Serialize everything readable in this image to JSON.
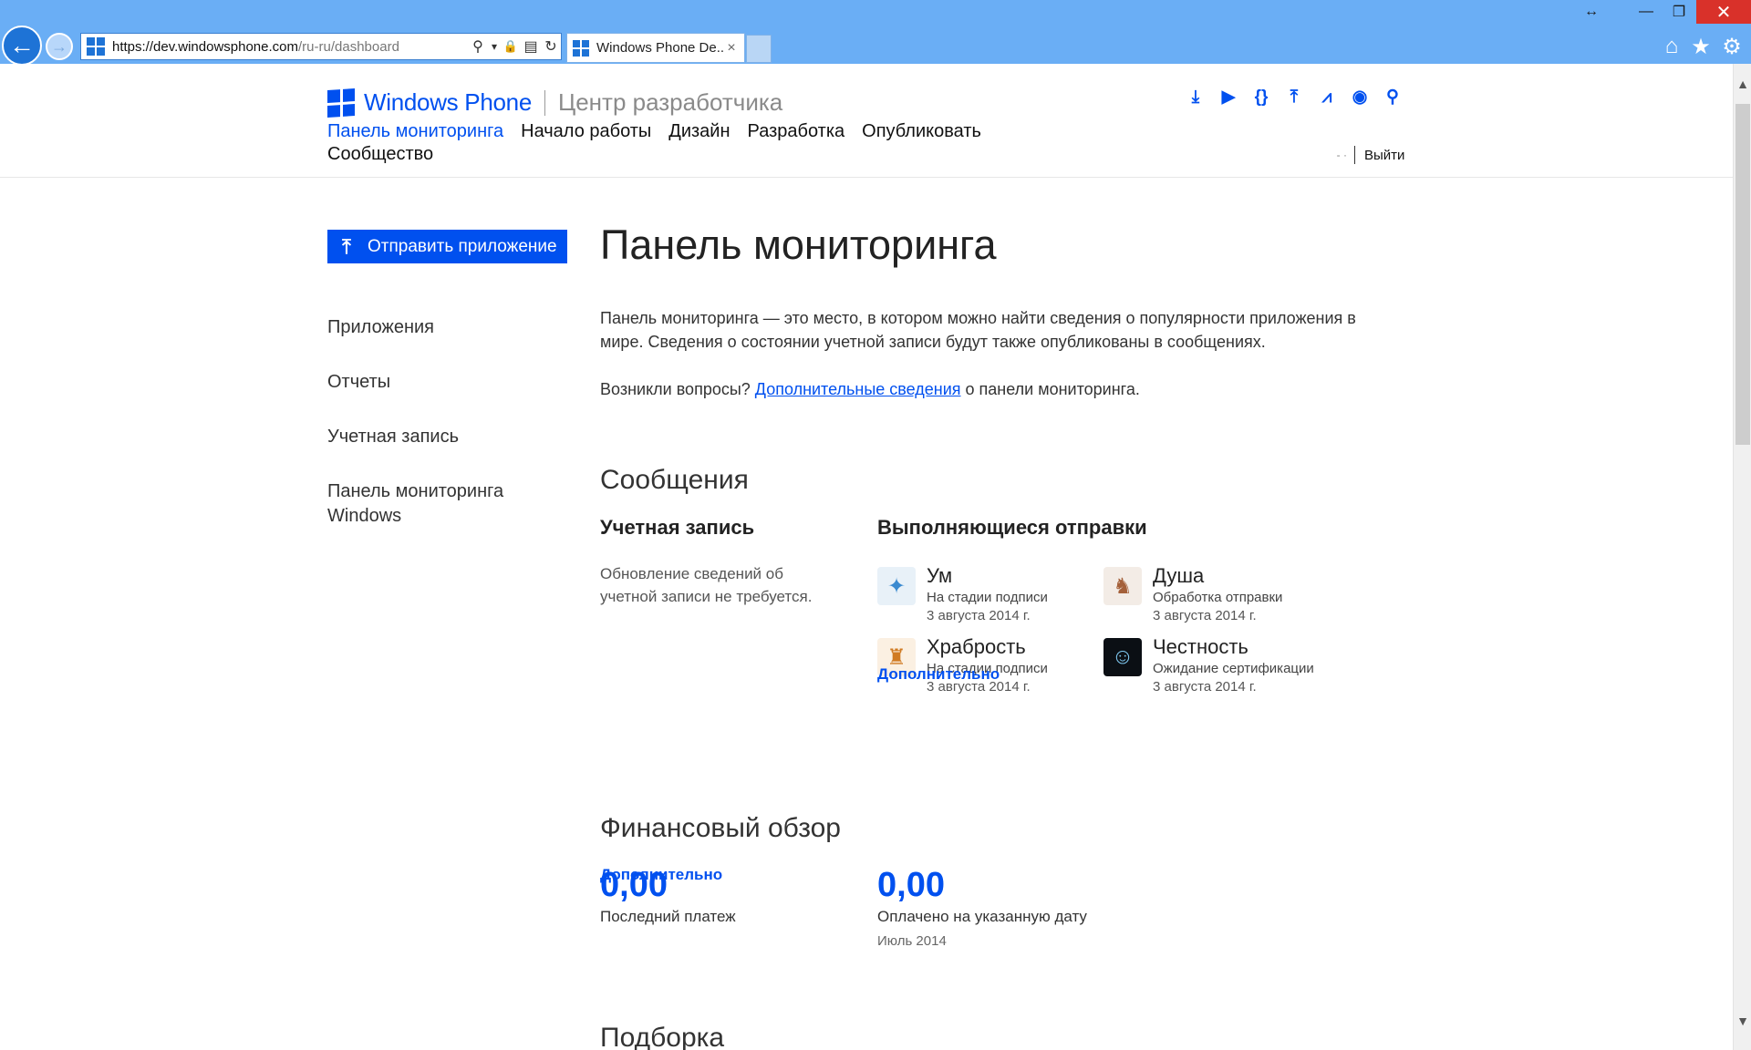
{
  "browser": {
    "url_prefix": "https://dev.windowsphone.com",
    "url_path": "/ru-ru/dashboard",
    "tab_title": "Windows Phone De...",
    "tab_close": "×",
    "icons": {
      "back": "←",
      "forward": "→",
      "search": "⚲",
      "dropdown": "▾",
      "lock": "🔒",
      "compat": "▤",
      "refresh": "↻",
      "restore": "↔",
      "minimize": "—",
      "maximize": "❐",
      "close": "✕",
      "home": "⌂",
      "favorites": "★",
      "tools": "⚙"
    }
  },
  "site": {
    "brand": "Windows Phone",
    "subtitle": "Центр разработчика",
    "top_icons": [
      {
        "name": "download-icon",
        "glyph": "⤓"
      },
      {
        "name": "play-icon",
        "glyph": "▶"
      },
      {
        "name": "code-icon",
        "glyph": "{}"
      },
      {
        "name": "upload-icon",
        "glyph": "⤒"
      },
      {
        "name": "chart-icon",
        "glyph": "⩘"
      },
      {
        "name": "eye-icon",
        "glyph": "◉"
      },
      {
        "name": "search-icon",
        "glyph": "⚲"
      }
    ],
    "nav": [
      {
        "label": "Панель мониторинга",
        "active": true
      },
      {
        "label": "Начало работы",
        "active": false
      },
      {
        "label": "Дизайн",
        "active": false
      },
      {
        "label": "Разработка",
        "active": false
      },
      {
        "label": "Опубликовать",
        "active": false
      },
      {
        "label": "Сообщество",
        "active": false
      }
    ],
    "user_name": "-       ·",
    "signout": "Выйти",
    "brand_color": "#0050ef"
  },
  "sidebar": {
    "submit_icon": "⤒",
    "submit_label": "Отправить приложение",
    "items": [
      {
        "label": "Приложения"
      },
      {
        "label": "Отчеты"
      },
      {
        "label": "Учетная запись"
      },
      {
        "label": "Панель мониторинга Windows"
      }
    ]
  },
  "main": {
    "title": "Панель мониторинга",
    "intro": "Панель мониторинга — это место, в котором можно найти сведения о популярности приложения в мире. Сведения о состоянии учетной записи будут также опубликованы в сообщениях.",
    "questions_prefix": "Возникли вопросы? ",
    "questions_link": "Дополнительные сведения",
    "questions_suffix": " о панели мониторинга.",
    "messages": {
      "title": "Сообщения",
      "account": {
        "heading": "Учетная запись",
        "text": "Обновление сведений об учетной записи не требуется.",
        "more": "Дополнительно"
      },
      "submissions": {
        "heading": "Выполняющиеся отправки",
        "items": [
          {
            "name": "Ум",
            "status": "На стадии подписи",
            "date": "3 августа 2014 г.",
            "icon": "✦",
            "icon_bg": "#e8f1f8",
            "icon_color": "#3a8ad0"
          },
          {
            "name": "Душа",
            "status": "Обработка отправки",
            "date": "3 августа 2014 г.",
            "icon": "♞",
            "icon_bg": "#f3ece6",
            "icon_color": "#a4603a"
          },
          {
            "name": "Храбрость",
            "status": "На стадии подписи",
            "date": "3 августа 2014 г.",
            "icon": "♜",
            "icon_bg": "#fbf0e2",
            "icon_color": "#d07a22"
          },
          {
            "name": "Честность",
            "status": "Ожидание сертификации",
            "date": "3 августа 2014 г.",
            "icon": "☺",
            "icon_bg": "#0b0f14",
            "icon_color": "#7fc8f0"
          }
        ],
        "more": "Дополнительно"
      }
    },
    "finance": {
      "title": "Финансовый обзор",
      "last_payment": {
        "amount": "0,00",
        "label": "Последний платеж"
      },
      "paid_to_date": {
        "amount": "0,00",
        "label": "Оплачено на указанную дату",
        "period": "Июль 2014"
      }
    },
    "picks_title": "Подборка"
  }
}
